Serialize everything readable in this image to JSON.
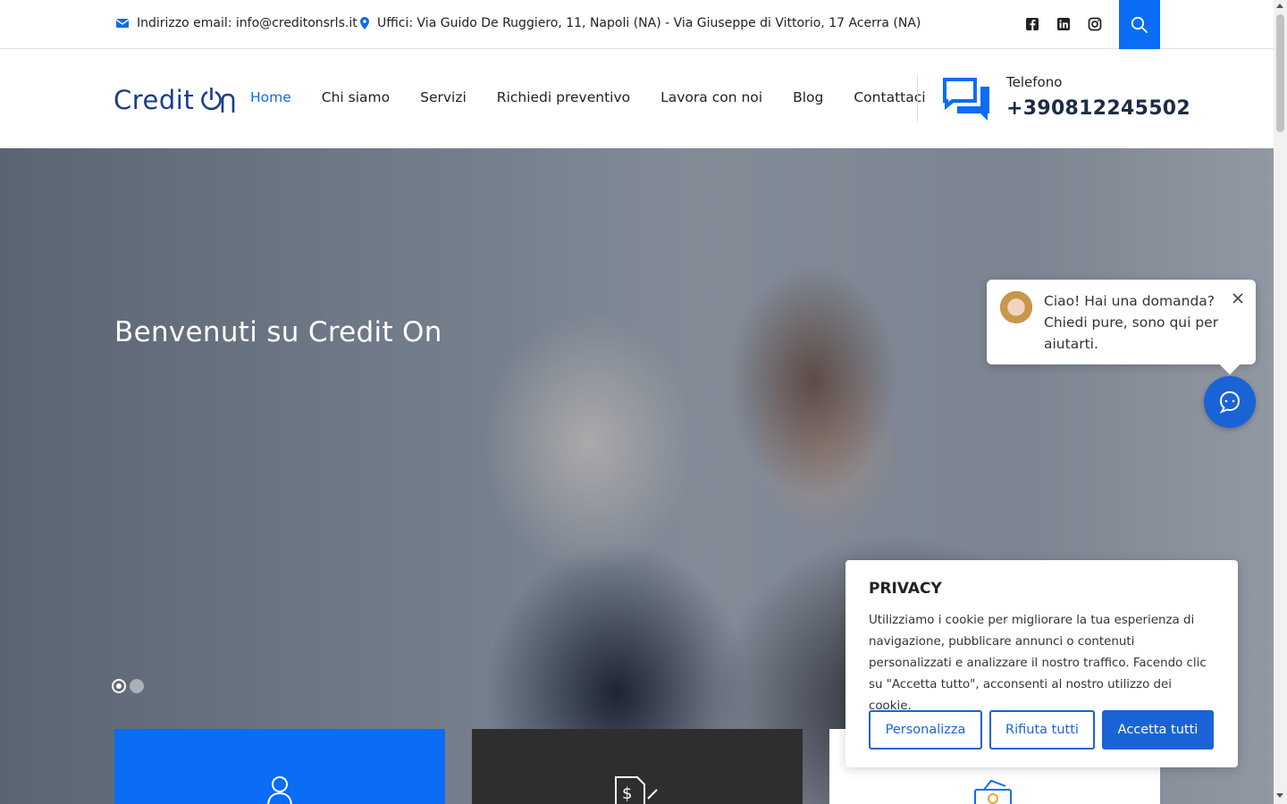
{
  "topbar": {
    "email_label": "Indirizzo email: info@creditonsrls.it",
    "address_label": "Uffici: Via Guido De Ruggiero, 11, Napoli (NA) - Via Giuseppe di Vittorio, 17 Acerra (NA)",
    "social_icons": [
      "facebook-icon",
      "linkedin-icon",
      "instagram-icon"
    ],
    "search_icon": "search-icon"
  },
  "header": {
    "logo_text": "Credit",
    "nav": [
      {
        "label": "Home",
        "active": true
      },
      {
        "label": "Chi siamo"
      },
      {
        "label": "Servizi"
      },
      {
        "label": "Richiedi preventivo"
      },
      {
        "label": "Lavora con noi"
      },
      {
        "label": "Blog"
      },
      {
        "label": "Contattaci"
      }
    ],
    "phone_label": "Telefono",
    "phone_number": "+390812245502"
  },
  "hero": {
    "title": "Benvenuti su Credit On",
    "slides_total": 2,
    "active_slide": 1
  },
  "chat": {
    "message": "Ciao! Hai una domanda? Chiedi pure, sono qui per aiutarti."
  },
  "privacy": {
    "title": "PRIVACY",
    "text": "Utilizziamo i cookie per migliorare la tua esperienza di navigazione, pubblicare annunci o contenuti personalizzati e analizzare il nostro traffico. Facendo clic su \"Accetta tutto\", acconsenti al nostro utilizzo dei cookie.",
    "customize_label": "Personalizza",
    "reject_label": "Rifiuta tutti",
    "accept_label": "Accetta tutti"
  },
  "colors": {
    "accent": "#0b6cf5",
    "button_blue": "#1a63d6",
    "logo": "#1a3d8c"
  }
}
